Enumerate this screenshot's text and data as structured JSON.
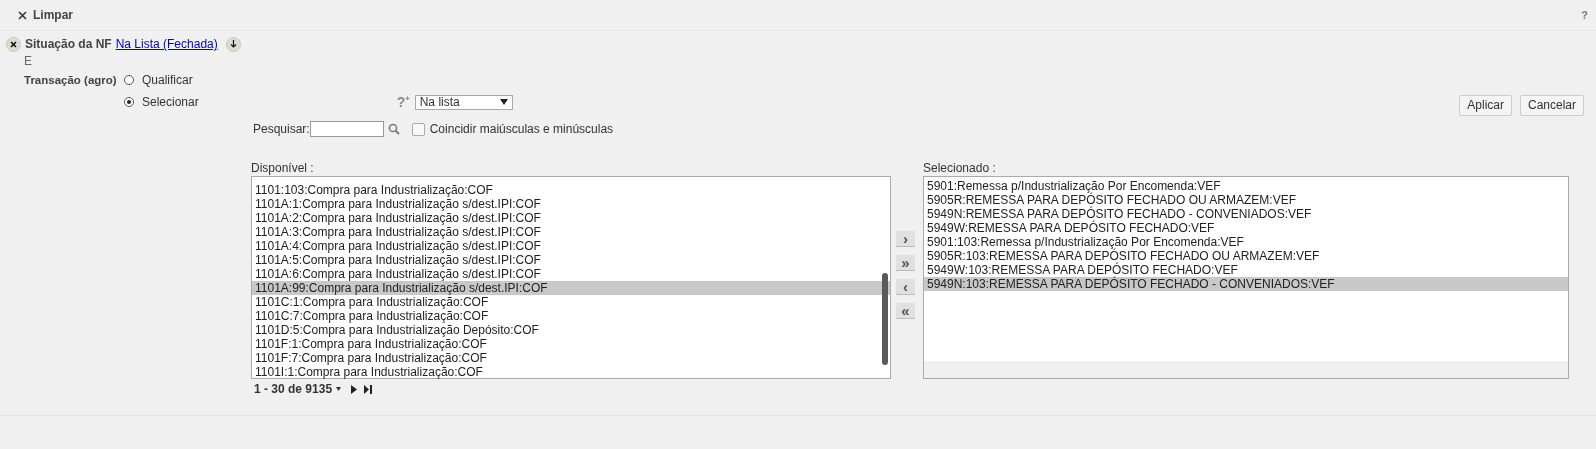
{
  "toolbar": {
    "clear_label": "Limpar",
    "help": "?"
  },
  "filter": {
    "label": "Situação da NF",
    "value_link": "Na Lista (Fechada)"
  },
  "conjunction": "E",
  "transaction": {
    "label": "Transação (agro)",
    "modes": [
      {
        "label": "Qualificar",
        "selected": false
      },
      {
        "label": "Selecionar",
        "selected": true
      }
    ]
  },
  "operator": {
    "help": "?$^{+}$",
    "value": "Na lista"
  },
  "buttons": [
    "Aplicar",
    "Cancelar"
  ],
  "search": {
    "label": "Pesquisar:"
  },
  "match_case": {
    "label": "Coincidir maiúsculas e minúsculas",
    "checked": false
  },
  "available": {
    "label": "Disponível :",
    "items": [
      {
        "text": "1101:103:Compra para Industrialização:COF",
        "selected": false
      },
      {
        "text": "1101A:1:Compra para Industrialização s/dest.IPI:COF",
        "selected": false
      },
      {
        "text": "1101A:2:Compra para Industrialização s/dest.IPI:COF",
        "selected": false
      },
      {
        "text": "1101A:3:Compra para Industrialização s/dest.IPI:COF",
        "selected": false
      },
      {
        "text": "1101A:4:Compra para Industrialização s/dest.IPI:COF",
        "selected": false
      },
      {
        "text": "1101A:5:Compra para Industrialização s/dest.IPI:COF",
        "selected": false
      },
      {
        "text": "1101A:6:Compra para Industrialização s/dest.IPI:COF",
        "selected": false
      },
      {
        "text": "1101A:99:Compra para Industrialização s/dest.IPI:COF",
        "selected": true
      },
      {
        "text": "1101C:1:Compra para Industrialização:COF",
        "selected": false
      },
      {
        "text": "1101C:7:Compra para Industrialização:COF",
        "selected": false
      },
      {
        "text": "1101D:5:Compra para Industrialização Depósito:COF",
        "selected": false
      },
      {
        "text": "1101F:1:Compra para Industrialização:COF",
        "selected": false
      },
      {
        "text": "1101F:7:Compra para Industrialização:COF",
        "selected": false
      },
      {
        "text": "1101I:1:Compra para Industrialização:COF",
        "selected": false
      }
    ],
    "pagination": "1 - 30 de 9135"
  },
  "move_buttons": [
    "›",
    "»",
    "‹",
    "«"
  ],
  "chosen": {
    "label": "Selecionado :",
    "items": [
      {
        "text": "5901:Remessa p/Industrialização Por Encomenda:VEF",
        "selected": false
      },
      {
        "text": "5905R:REMESSA PARA DEPÓSITO FECHADO OU ARMAZEM:VEF",
        "selected": false
      },
      {
        "text": "5949N:REMESSA PARA DEPÓSITO FECHADO - CONVENIADOS:VEF",
        "selected": false
      },
      {
        "text": "5949W:REMESSA PARA DEPÓSITO FECHADO:VEF",
        "selected": false
      },
      {
        "text": "5901:103:Remessa p/Industrialização Por Encomenda:VEF",
        "selected": false
      },
      {
        "text": "5905R:103:REMESSA PARA DEPÓSITO FECHADO OU ARMAZEM:VEF",
        "selected": false
      },
      {
        "text": "5949W:103:REMESSA PARA DEPÓSITO FECHADO:VEF",
        "selected": false
      },
      {
        "text": "5949N:103:REMESSA PARA DEPÓSITO FECHADO - CONVENIADOS:VEF",
        "selected": true
      }
    ]
  }
}
